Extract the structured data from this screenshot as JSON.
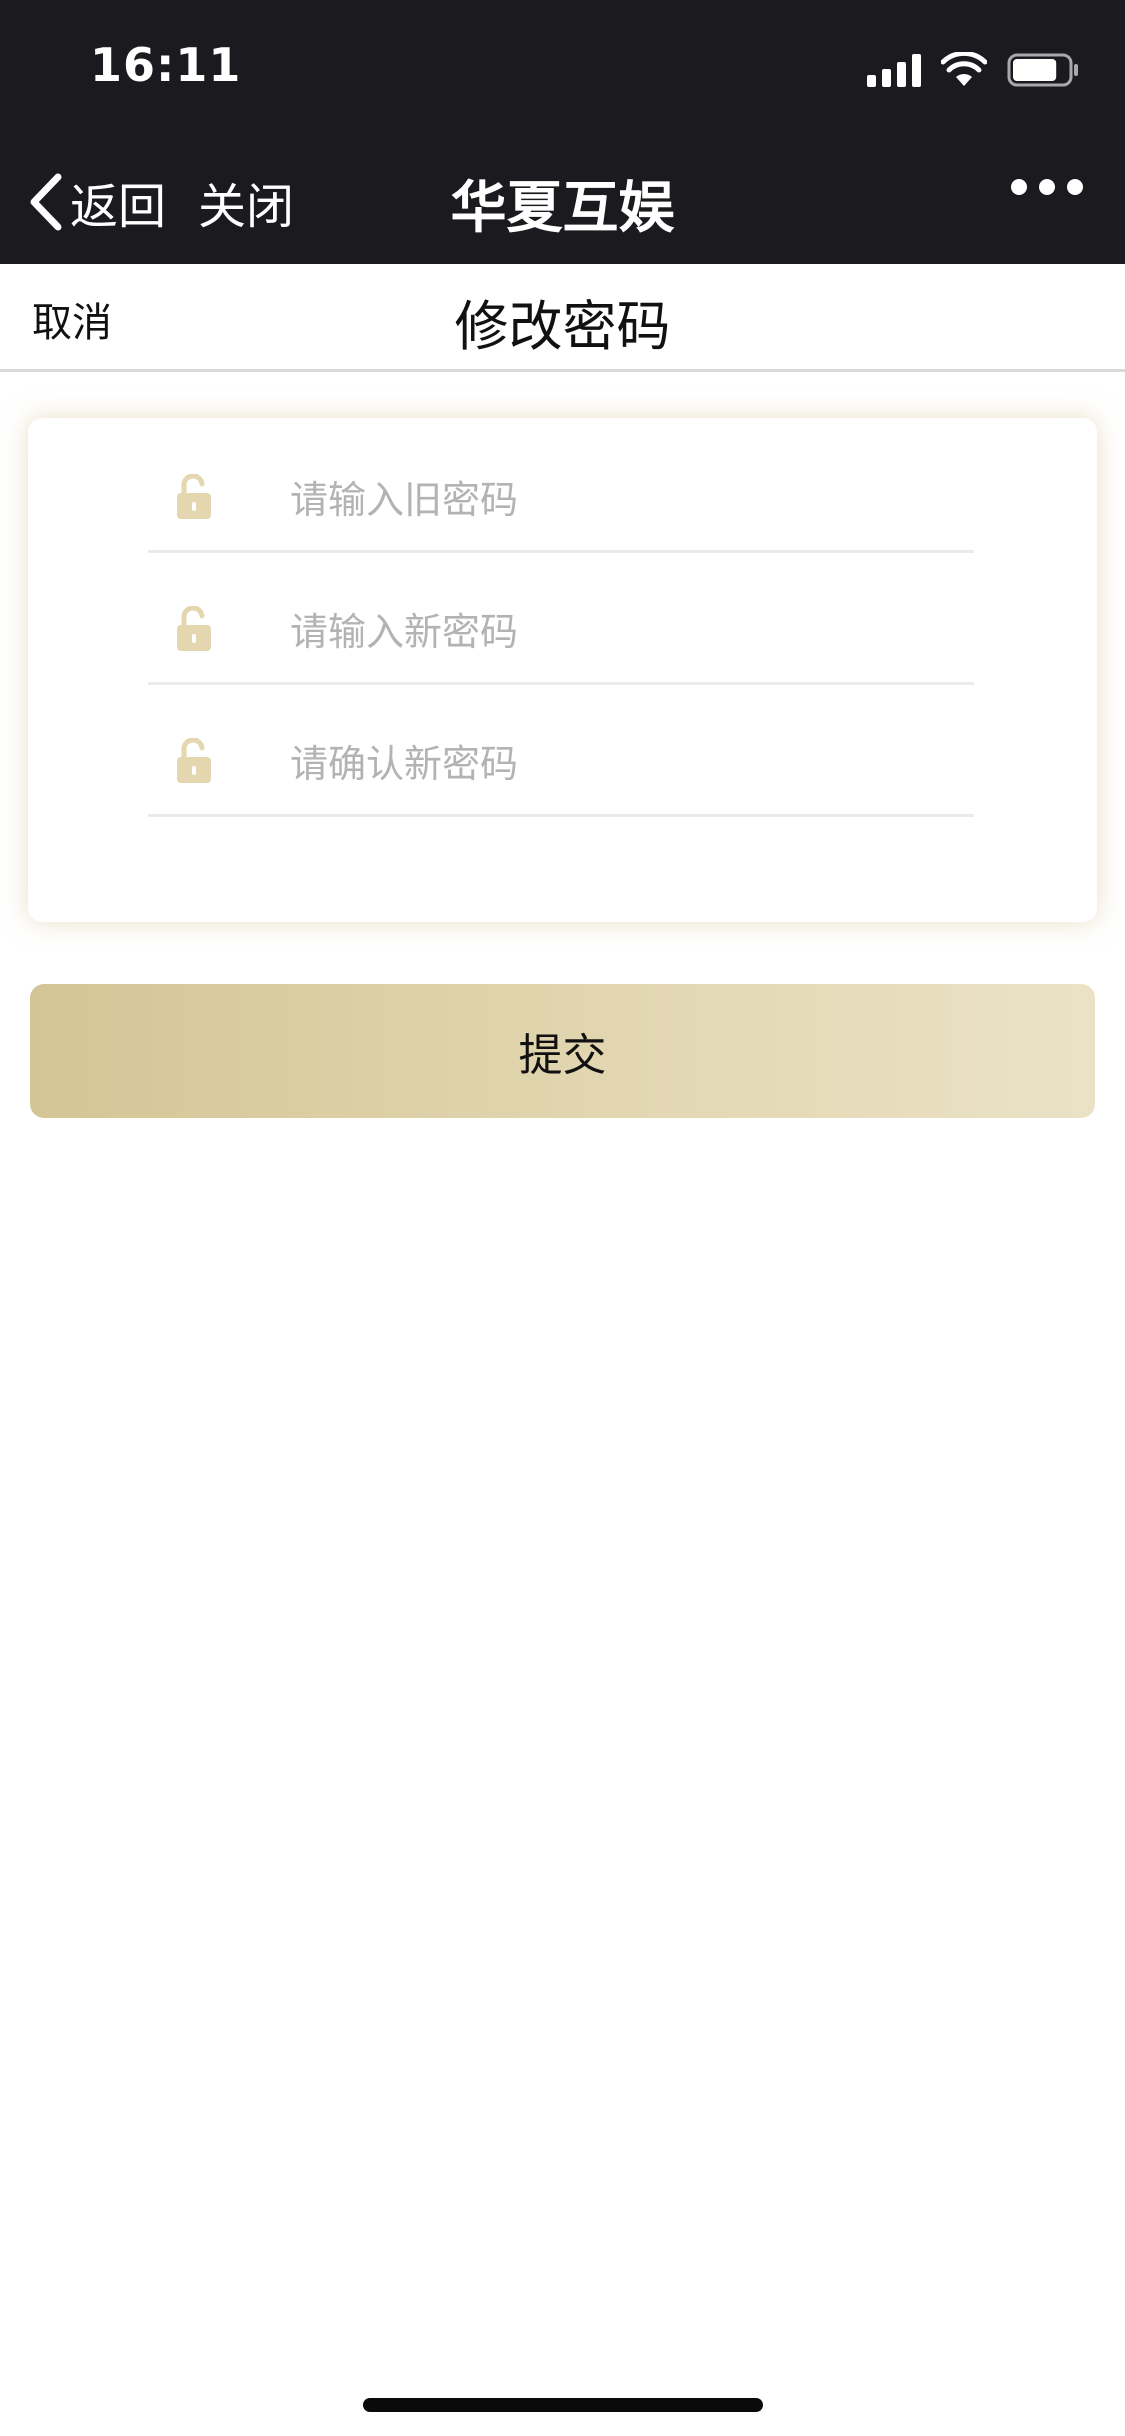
{
  "status_bar": {
    "time": "16:11",
    "battery_level": 0.8,
    "icons": [
      "signal-icon",
      "wifi-icon",
      "battery-icon"
    ]
  },
  "nav_bar": {
    "back_label": "返回",
    "close_label": "关闭",
    "title": "华夏互娱",
    "icons": [
      "chevron-left-icon",
      "more-icon"
    ]
  },
  "sub_header": {
    "cancel_label": "取消",
    "title": "修改密码"
  },
  "form": {
    "fields": [
      {
        "placeholder": "请输入旧密码",
        "value": "",
        "icon": "lock-icon"
      },
      {
        "placeholder": "请输入新密码",
        "value": "",
        "icon": "lock-icon"
      },
      {
        "placeholder": "请确认新密码",
        "value": "",
        "icon": "lock-icon"
      }
    ],
    "submit_label": "提交"
  },
  "colors": {
    "topbar_bg": "#1b1a1f",
    "accent_gold": "#d4c596",
    "accent_gold_light": "#ebe2c6",
    "placeholder": "#b3b3b3"
  }
}
